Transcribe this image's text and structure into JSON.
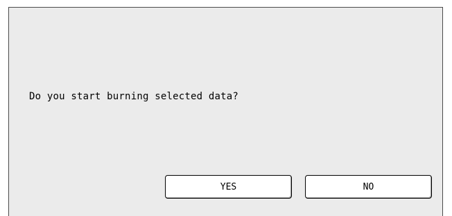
{
  "dialog": {
    "message": "Do you start burning selected data?",
    "buttons": {
      "yes_label": "YES",
      "no_label": "NO"
    }
  }
}
